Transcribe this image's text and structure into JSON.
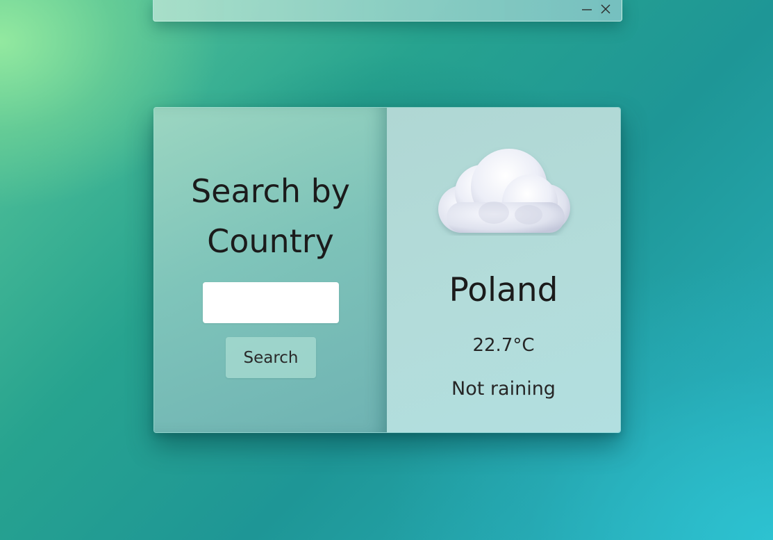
{
  "window": {
    "minimize_icon": "minimize-icon",
    "close_icon": "close-icon"
  },
  "search": {
    "title": "Search by Country",
    "input_value": "",
    "button_label": "Search"
  },
  "weather": {
    "icon": "cloud-icon",
    "country": "Poland",
    "temperature": "22.7°C",
    "rain_status": "Not raining"
  },
  "colors": {
    "bg_top_left": "#8ee6a0",
    "bg_bottom_right": "#2bbfd0",
    "left_panel": "#8fcdbf",
    "right_panel": "#b1dada",
    "button": "#aadcd2",
    "text": "#1b1b1b"
  }
}
